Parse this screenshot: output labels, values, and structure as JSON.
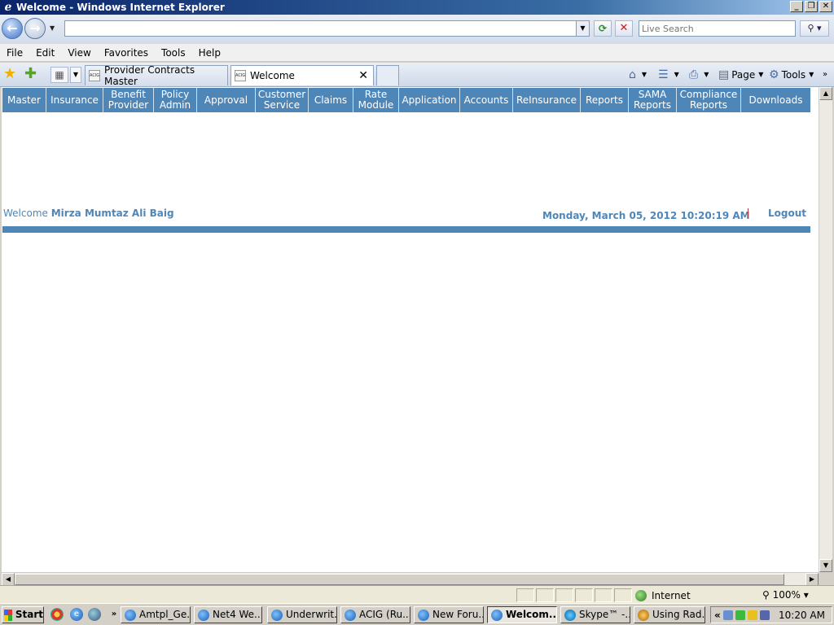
{
  "window": {
    "title": "Welcome - Windows Internet Explorer"
  },
  "browser": {
    "search_placeholder": "Live Search",
    "menu": [
      "File",
      "Edit",
      "View",
      "Favorites",
      "Tools",
      "Help"
    ],
    "tabs": [
      {
        "label": "Provider Contracts Master",
        "active": false
      },
      {
        "label": "Welcome",
        "active": true
      }
    ],
    "commands": {
      "page": "Page",
      "tools": "Tools"
    },
    "status": {
      "zone": "Internet",
      "zoom": "100%"
    }
  },
  "app": {
    "nav": [
      {
        "label": "Master"
      },
      {
        "label": "Insurance"
      },
      {
        "label": "Benefit\nProvider"
      },
      {
        "label": "Policy\nAdmin"
      },
      {
        "label": "Approval"
      },
      {
        "label": "Customer\nService"
      },
      {
        "label": "Claims"
      },
      {
        "label": "Rate\nModule"
      },
      {
        "label": "Application"
      },
      {
        "label": "Accounts"
      },
      {
        "label": "ReInsurance"
      },
      {
        "label": "Reports"
      },
      {
        "label": "SAMA\nReports"
      },
      {
        "label": "Compliance\nReports"
      },
      {
        "label": "Downloads"
      }
    ],
    "welcome_prefix": "Welcome",
    "user_name": "Mirza Mumtaz Ali Baig",
    "date": "Monday, March 05, 2012",
    "time": "10:20:19 AM",
    "logout": "Logout",
    "accent_color": "#4f86b8"
  },
  "taskbar": {
    "start": "Start",
    "items": [
      {
        "label": "Amtpl_Ge..."
      },
      {
        "label": "Net4 We..."
      },
      {
        "label": "Underwrit..."
      },
      {
        "label": "ACIG (Ru..."
      },
      {
        "label": "New Foru..."
      },
      {
        "label": "Welcom..."
      },
      {
        "label": "Skype™ -..."
      },
      {
        "label": "Using Rad..."
      }
    ],
    "clock": "10:20 AM"
  }
}
